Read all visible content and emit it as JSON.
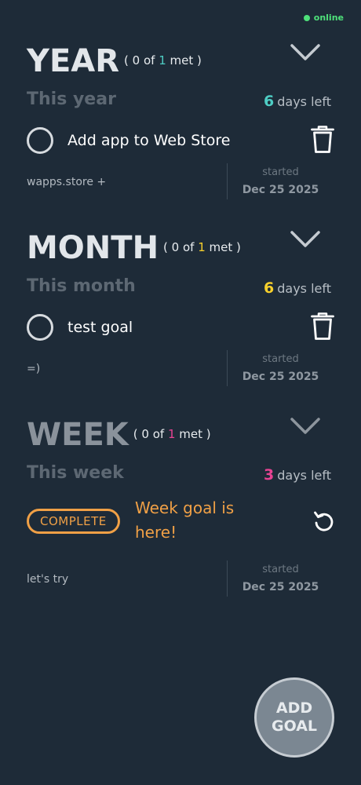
{
  "status": {
    "label": "online"
  },
  "colors": {
    "year_accent": "#4ecdc4",
    "month_accent": "#f7d02c",
    "week_accent": "#e84393",
    "complete": "#f0a046"
  },
  "sections": {
    "year": {
      "title": "YEAR",
      "met_prefix": "( 0 of ",
      "met_total": "1",
      "met_suffix": " met )",
      "period": "This year",
      "days_left_num": "6",
      "days_left_label": "days left",
      "goal": {
        "title": "Add app to Web Store",
        "note": "wapps.store +",
        "started_label": "started",
        "started_date": "Dec 25 2025"
      }
    },
    "month": {
      "title": "MONTH",
      "met_prefix": "( 0 of ",
      "met_total": "1",
      "met_suffix": " met )",
      "period": "This month",
      "days_left_num": "6",
      "days_left_label": "days left",
      "goal": {
        "title": "test goal",
        "note": "=)",
        "started_label": "started",
        "started_date": "Dec 25 2025"
      }
    },
    "week": {
      "title": "WEEK",
      "met_prefix": "( 0 of ",
      "met_total": "1",
      "met_suffix": " met )",
      "period": "This week",
      "days_left_num": "3",
      "days_left_label": "days left",
      "goal": {
        "badge": "COMPLETE",
        "title": "Week goal is here!",
        "note": "let's try",
        "started_label": "started",
        "started_date": "Dec 25 2025"
      }
    }
  },
  "add_button": {
    "label": "ADD\nGOAL"
  }
}
